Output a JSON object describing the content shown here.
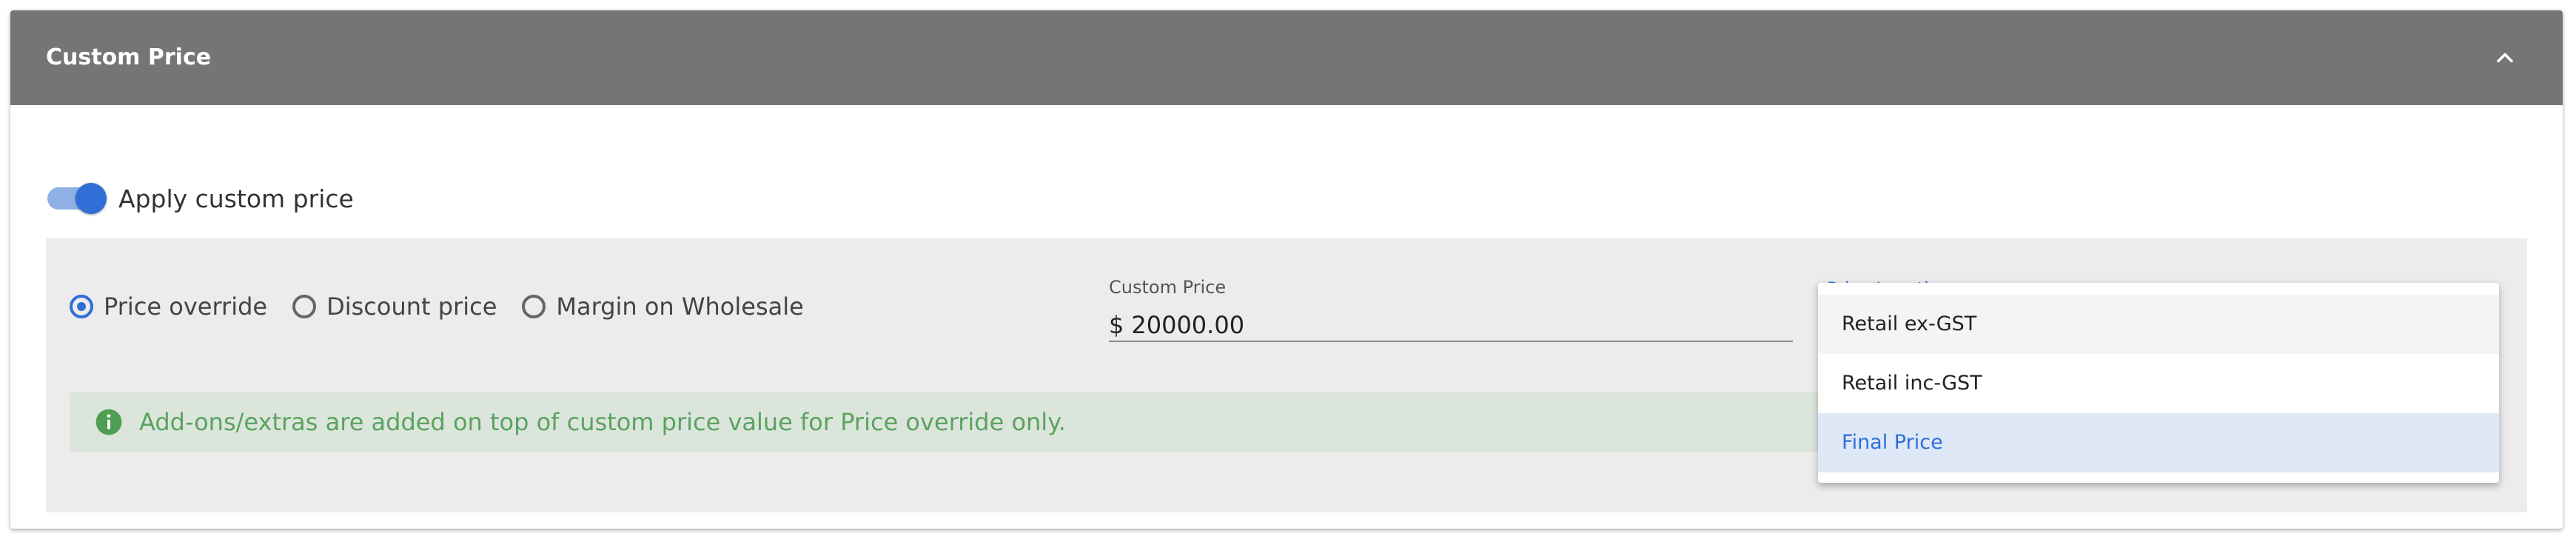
{
  "panel": {
    "title": "Custom Price",
    "collapse_icon": "chevron-up-icon"
  },
  "toggle": {
    "label": "Apply custom price",
    "checked": true,
    "accent_color": "#2f6fd6"
  },
  "pricing_type": {
    "options": [
      {
        "label": "Price override",
        "checked": true
      },
      {
        "label": "Discount price",
        "checked": false
      },
      {
        "label": "Margin on Wholesale",
        "checked": false
      }
    ]
  },
  "custom_price": {
    "label": "Custom Price",
    "prefix": "$",
    "value": "20000.00"
  },
  "price_location": {
    "label": "Price Location",
    "options": [
      {
        "label": "Retail ex-GST",
        "state": "hovered"
      },
      {
        "label": "Retail inc-GST",
        "state": "normal"
      },
      {
        "label": "Final Price",
        "state": "selected"
      }
    ]
  },
  "info": {
    "icon": "info-icon",
    "text": "Add-ons/extras are added on top of custom price value for Price override only.",
    "color": "#5aa35e"
  },
  "colors": {
    "header_bg": "#757575",
    "inner_bg": "#ececec",
    "info_bg": "#dbe5dc",
    "selected_option_bg": "#dfe8f6"
  }
}
